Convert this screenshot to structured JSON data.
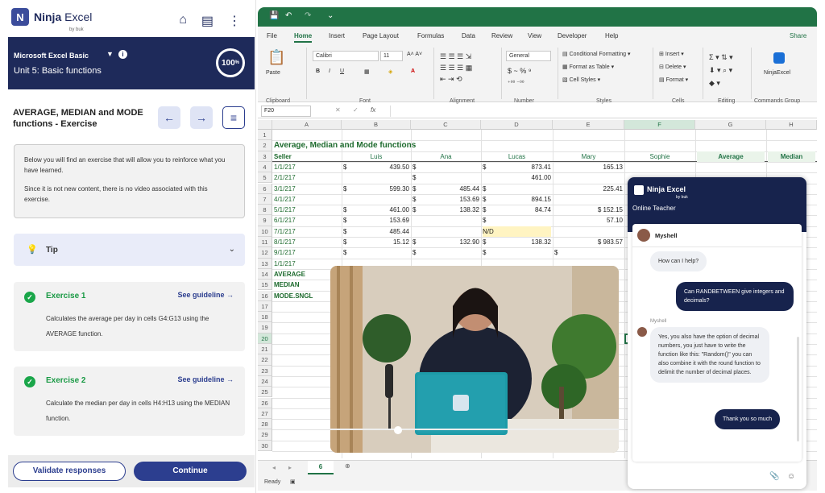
{
  "brand": {
    "name_bold": "Ninja",
    "name_rest": " Excel",
    "sub": "by buk"
  },
  "course": {
    "name": "Microsoft Excel Basic",
    "unit": "Unit 5: Basic functions",
    "progress": "100"
  },
  "lesson": {
    "title": "AVERAGE, MEDIAN and MODE functions - Exercise"
  },
  "intro": {
    "p1": "Below you will find an exercise that will allow you to reinforce what you have learned.",
    "p2": "Since it is not new content, there is no video associated with this exercise."
  },
  "tip": {
    "label": "Tip"
  },
  "exercises": [
    {
      "title": "Exercise 1",
      "guide": "See guideline",
      "desc": "Calculates the average per day in cells G4:G13 using the AVERAGE function."
    },
    {
      "title": "Exercise 2",
      "guide": "See guideline",
      "desc": "Calculate the median per day in cells H4:H13 using the MEDIAN function."
    }
  ],
  "footer": {
    "validate": "Validate responses",
    "continue": "Continue"
  },
  "excel": {
    "menus": [
      "File",
      "Home",
      "Insert",
      "Page Layout",
      "Formulas",
      "Data",
      "Review",
      "View",
      "Developer",
      "Help"
    ],
    "share": "Share",
    "ribbon": {
      "paste": "Paste",
      "font": "Calibri",
      "size": "11",
      "numfmt": "General",
      "cond": "Conditional Formatting",
      "fmt_table": "Format as Table",
      "cell_styles": "Cell Styles",
      "insert": "Insert",
      "delete": "Delete",
      "format": "Format",
      "addin": "NinjaExcel",
      "groups": [
        "Clipboard",
        "Font",
        "Alignment",
        "Number",
        "Styles",
        "Cells",
        "Editing",
        "Commands Group"
      ]
    },
    "namebox": "F20",
    "cols": [
      "A",
      "B",
      "C",
      "D",
      "E",
      "F",
      "G",
      "H"
    ],
    "sheet_title": "Average, Median and Mode functions",
    "headers": [
      "Seller",
      "Luis",
      "Ana",
      "Lucas",
      "Mary",
      "Sophie",
      "Average",
      "Median"
    ],
    "rows": [
      [
        "1/1/217",
        "$",
        "439.50",
        "",
        "$",
        "873.41",
        "$",
        "165.13"
      ],
      [
        "2/1/217",
        "",
        "",
        "",
        "$",
        "461.00",
        "",
        ""
      ],
      [
        "3/1/217",
        "$",
        "599.30",
        "$",
        "485.44",
        "",
        "$",
        "225.41"
      ],
      [
        "4/1/217",
        "",
        "",
        "$",
        "153.69",
        "$",
        "894.15",
        ""
      ],
      [
        "5/1/217",
        "$",
        "461.00",
        "$",
        "138.32",
        "$",
        "84.74",
        "$ 152.15"
      ],
      [
        "6/1/217",
        "$",
        "153.69",
        "",
        "",
        "",
        "$",
        "57.10"
      ],
      [
        "7/1/217",
        "$",
        "485.44",
        "",
        "",
        "N/D",
        "",
        ""
      ],
      [
        "8/1/217",
        "$",
        "15.12",
        "$",
        "132.90",
        "$",
        "138.32",
        "$ 983.57"
      ],
      [
        "9/1/217",
        "$",
        "",
        "$",
        "",
        "$",
        "",
        "$"
      ],
      [
        "1/1/217",
        "",
        "",
        "",
        "",
        "",
        "",
        ""
      ]
    ],
    "stats": [
      "AVERAGE",
      "MEDIAN",
      "MODE.SNGL"
    ],
    "sheet_tab": "6",
    "status": "Ready"
  },
  "chat": {
    "brand": "Ninja Excel",
    "sub": "by buk",
    "title": "Online Teacher",
    "agent": "Myshell",
    "m1": "How can I help?",
    "m2": "Can RANDBETWEEN give integers and decimals?",
    "m3_name": "Myshell",
    "m3": "Yes, you also have the option of decimal numbers, you just have to write the function like this: \"Random()\" you can also combine it with the round function to delimit the number of decimal places.",
    "m4": "Thank you so much"
  }
}
